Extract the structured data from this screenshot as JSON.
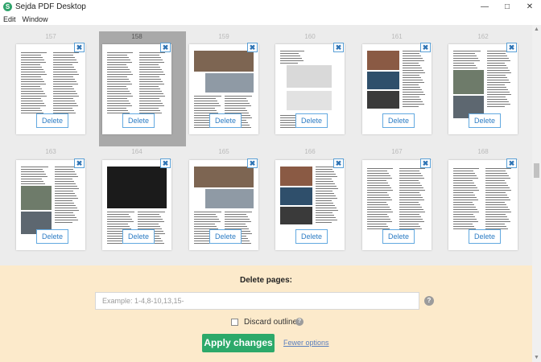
{
  "window": {
    "title": "Sejda PDF Desktop",
    "logo_letter": "S",
    "controls": {
      "minimize": "—",
      "maximize": "□",
      "close": "✕"
    }
  },
  "menu": {
    "items": [
      "Edit",
      "Window"
    ]
  },
  "pages": [
    {
      "number": "157",
      "selected": false,
      "thumb": "text",
      "delete_label": "Delete",
      "close_icon": "✖"
    },
    {
      "number": "158",
      "selected": true,
      "thumb": "text",
      "delete_label": "Delete",
      "close_icon": "✖"
    },
    {
      "number": "159",
      "selected": false,
      "thumb": "photo-top",
      "delete_label": "Delete",
      "close_icon": "✖"
    },
    {
      "number": "160",
      "selected": false,
      "thumb": "plan",
      "delete_label": "Delete",
      "close_icon": "✖"
    },
    {
      "number": "161",
      "selected": false,
      "thumb": "photo-mixed",
      "delete_label": "Delete",
      "close_icon": "✖"
    },
    {
      "number": "162",
      "selected": false,
      "thumb": "photo-left",
      "delete_label": "Delete",
      "close_icon": "✖"
    },
    {
      "number": "163",
      "selected": false,
      "thumb": "photo-left",
      "delete_label": "Delete",
      "close_icon": "✖"
    },
    {
      "number": "164",
      "selected": false,
      "thumb": "photo-dark",
      "delete_label": "Delete",
      "close_icon": "✖"
    },
    {
      "number": "165",
      "selected": false,
      "thumb": "photo-top",
      "delete_label": "Delete",
      "close_icon": "✖"
    },
    {
      "number": "166",
      "selected": false,
      "thumb": "photo-mixed",
      "delete_label": "Delete",
      "close_icon": "✖"
    },
    {
      "number": "167",
      "selected": false,
      "thumb": "text",
      "delete_label": "Delete",
      "close_icon": "✖"
    },
    {
      "number": "168",
      "selected": false,
      "thumb": "text",
      "delete_label": "Delete",
      "close_icon": "✖"
    }
  ],
  "delete_panel": {
    "title": "Delete pages:",
    "input_value": "",
    "input_placeholder": "Example: 1-4,8-10,13,15-",
    "help_icon": "?",
    "discard_outline_label": "Discard outline",
    "discard_outline_checked": false,
    "apply_label": "Apply changes",
    "fewer_options_label": "Fewer options"
  },
  "colors": {
    "accent": "#2ca96a",
    "delete_border": "#62a9e0",
    "panel_bg": "#fde9c8",
    "selected_bg": "#a9a9a9"
  }
}
